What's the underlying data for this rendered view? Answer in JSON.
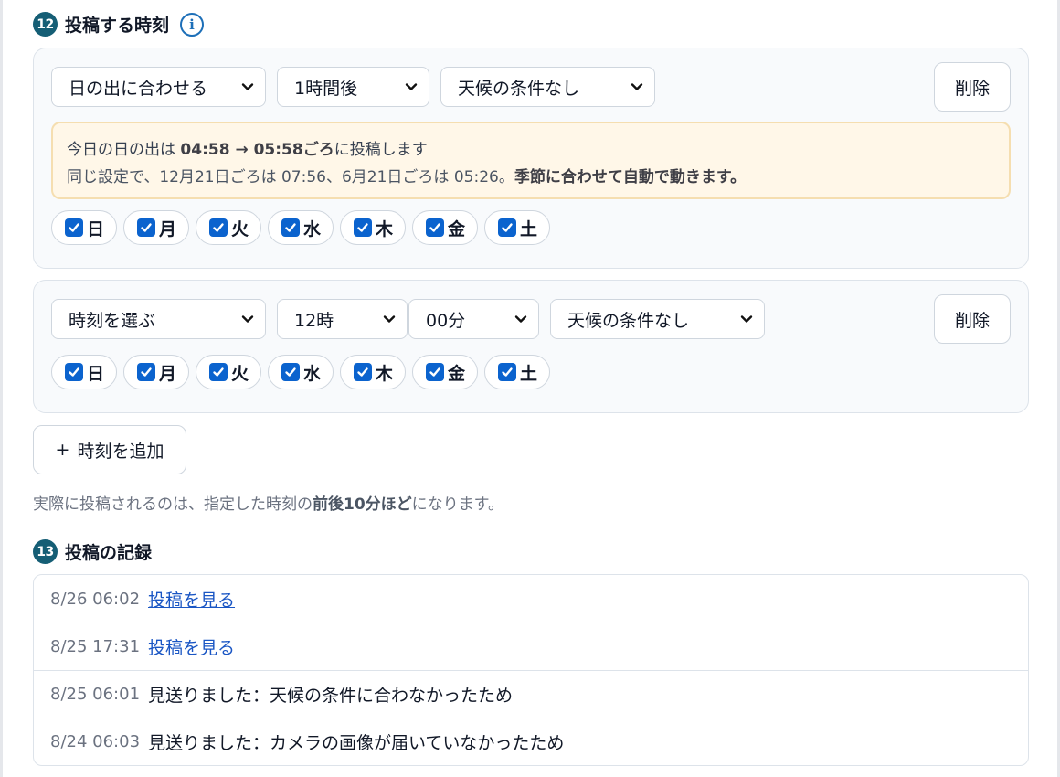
{
  "post_time_section": {
    "number": "12",
    "title": "投稿する時刻",
    "info_icon": "info-icon",
    "schedules": [
      {
        "mode": "日の出に合わせる",
        "offset": "1時間後",
        "weather": "天候の条件なし",
        "delete_label": "削除",
        "notice": {
          "line1_prefix": "今日の日の出は ",
          "line1_range": "04:58 → 05:58ごろ",
          "line1_suffix": "に投稿します",
          "line2_prefix": "同じ設定で、12月21日ごろは 07:56、6月21日ごろは 05:26。",
          "line2_bold": "季節に合わせて自動で動きます。"
        },
        "days": [
          {
            "label": "日",
            "checked": true
          },
          {
            "label": "月",
            "checked": true
          },
          {
            "label": "火",
            "checked": true
          },
          {
            "label": "水",
            "checked": true
          },
          {
            "label": "木",
            "checked": true
          },
          {
            "label": "金",
            "checked": true
          },
          {
            "label": "土",
            "checked": true
          }
        ]
      },
      {
        "mode": "時刻を選ぶ",
        "hour": "12時",
        "minute": "00分",
        "weather": "天候の条件なし",
        "delete_label": "削除",
        "days": [
          {
            "label": "日",
            "checked": true
          },
          {
            "label": "月",
            "checked": true
          },
          {
            "label": "火",
            "checked": true
          },
          {
            "label": "水",
            "checked": true
          },
          {
            "label": "木",
            "checked": true
          },
          {
            "label": "金",
            "checked": true
          },
          {
            "label": "土",
            "checked": true
          }
        ]
      }
    ],
    "add_button": {
      "icon": "+",
      "label": "時刻を追加"
    },
    "hint": {
      "prefix": "実際に投稿されるのは、指定した時刻の",
      "bold": "前後10分ほど",
      "suffix": "になります。"
    }
  },
  "log_section": {
    "number": "13",
    "title": "投稿の記録",
    "rows": [
      {
        "time": "8/26 06:02",
        "text": "投稿を見る",
        "is_link": true
      },
      {
        "time": "8/25 17:31",
        "text": "投稿を見る",
        "is_link": true
      },
      {
        "time": "8/25 06:01",
        "text": "見送りました：天候の条件に合わなかったため",
        "is_link": false
      },
      {
        "time": "8/24 06:03",
        "text": "見送りました：カメラの画像が届いていなかったため",
        "is_link": false
      }
    ]
  },
  "colors": {
    "badge": "#155e75",
    "checkbox": "#0b63ce",
    "link": "#1a56c4",
    "notice_bg": "#fff7e8"
  }
}
